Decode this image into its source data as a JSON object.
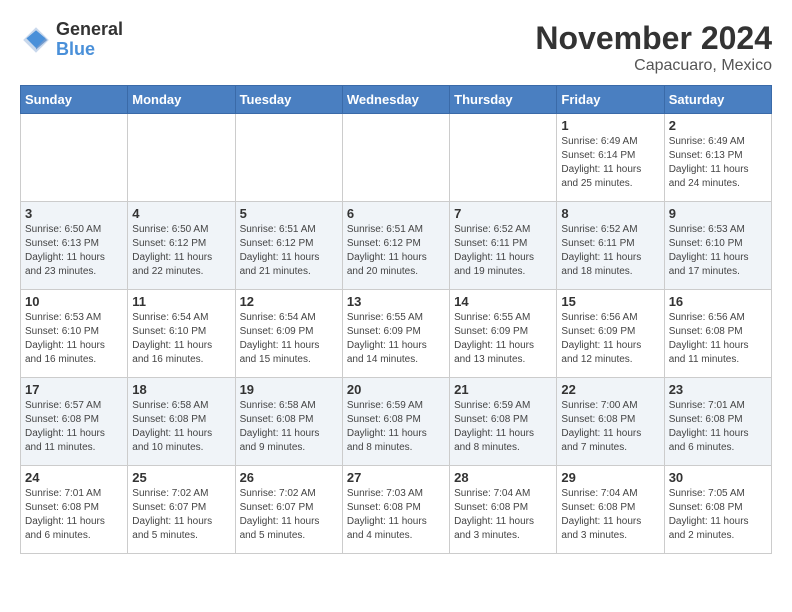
{
  "header": {
    "logo_line1": "General",
    "logo_line2": "Blue",
    "month": "November 2024",
    "location": "Capacuaro, Mexico"
  },
  "days_of_week": [
    "Sunday",
    "Monday",
    "Tuesday",
    "Wednesday",
    "Thursday",
    "Friday",
    "Saturday"
  ],
  "weeks": [
    [
      {
        "day": "",
        "info": ""
      },
      {
        "day": "",
        "info": ""
      },
      {
        "day": "",
        "info": ""
      },
      {
        "day": "",
        "info": ""
      },
      {
        "day": "",
        "info": ""
      },
      {
        "day": "1",
        "info": "Sunrise: 6:49 AM\nSunset: 6:14 PM\nDaylight: 11 hours and 25 minutes."
      },
      {
        "day": "2",
        "info": "Sunrise: 6:49 AM\nSunset: 6:13 PM\nDaylight: 11 hours and 24 minutes."
      }
    ],
    [
      {
        "day": "3",
        "info": "Sunrise: 6:50 AM\nSunset: 6:13 PM\nDaylight: 11 hours and 23 minutes."
      },
      {
        "day": "4",
        "info": "Sunrise: 6:50 AM\nSunset: 6:12 PM\nDaylight: 11 hours and 22 minutes."
      },
      {
        "day": "5",
        "info": "Sunrise: 6:51 AM\nSunset: 6:12 PM\nDaylight: 11 hours and 21 minutes."
      },
      {
        "day": "6",
        "info": "Sunrise: 6:51 AM\nSunset: 6:12 PM\nDaylight: 11 hours and 20 minutes."
      },
      {
        "day": "7",
        "info": "Sunrise: 6:52 AM\nSunset: 6:11 PM\nDaylight: 11 hours and 19 minutes."
      },
      {
        "day": "8",
        "info": "Sunrise: 6:52 AM\nSunset: 6:11 PM\nDaylight: 11 hours and 18 minutes."
      },
      {
        "day": "9",
        "info": "Sunrise: 6:53 AM\nSunset: 6:10 PM\nDaylight: 11 hours and 17 minutes."
      }
    ],
    [
      {
        "day": "10",
        "info": "Sunrise: 6:53 AM\nSunset: 6:10 PM\nDaylight: 11 hours and 16 minutes."
      },
      {
        "day": "11",
        "info": "Sunrise: 6:54 AM\nSunset: 6:10 PM\nDaylight: 11 hours and 16 minutes."
      },
      {
        "day": "12",
        "info": "Sunrise: 6:54 AM\nSunset: 6:09 PM\nDaylight: 11 hours and 15 minutes."
      },
      {
        "day": "13",
        "info": "Sunrise: 6:55 AM\nSunset: 6:09 PM\nDaylight: 11 hours and 14 minutes."
      },
      {
        "day": "14",
        "info": "Sunrise: 6:55 AM\nSunset: 6:09 PM\nDaylight: 11 hours and 13 minutes."
      },
      {
        "day": "15",
        "info": "Sunrise: 6:56 AM\nSunset: 6:09 PM\nDaylight: 11 hours and 12 minutes."
      },
      {
        "day": "16",
        "info": "Sunrise: 6:56 AM\nSunset: 6:08 PM\nDaylight: 11 hours and 11 minutes."
      }
    ],
    [
      {
        "day": "17",
        "info": "Sunrise: 6:57 AM\nSunset: 6:08 PM\nDaylight: 11 hours and 11 minutes."
      },
      {
        "day": "18",
        "info": "Sunrise: 6:58 AM\nSunset: 6:08 PM\nDaylight: 11 hours and 10 minutes."
      },
      {
        "day": "19",
        "info": "Sunrise: 6:58 AM\nSunset: 6:08 PM\nDaylight: 11 hours and 9 minutes."
      },
      {
        "day": "20",
        "info": "Sunrise: 6:59 AM\nSunset: 6:08 PM\nDaylight: 11 hours and 8 minutes."
      },
      {
        "day": "21",
        "info": "Sunrise: 6:59 AM\nSunset: 6:08 PM\nDaylight: 11 hours and 8 minutes."
      },
      {
        "day": "22",
        "info": "Sunrise: 7:00 AM\nSunset: 6:08 PM\nDaylight: 11 hours and 7 minutes."
      },
      {
        "day": "23",
        "info": "Sunrise: 7:01 AM\nSunset: 6:08 PM\nDaylight: 11 hours and 6 minutes."
      }
    ],
    [
      {
        "day": "24",
        "info": "Sunrise: 7:01 AM\nSunset: 6:08 PM\nDaylight: 11 hours and 6 minutes."
      },
      {
        "day": "25",
        "info": "Sunrise: 7:02 AM\nSunset: 6:07 PM\nDaylight: 11 hours and 5 minutes."
      },
      {
        "day": "26",
        "info": "Sunrise: 7:02 AM\nSunset: 6:07 PM\nDaylight: 11 hours and 5 minutes."
      },
      {
        "day": "27",
        "info": "Sunrise: 7:03 AM\nSunset: 6:08 PM\nDaylight: 11 hours and 4 minutes."
      },
      {
        "day": "28",
        "info": "Sunrise: 7:04 AM\nSunset: 6:08 PM\nDaylight: 11 hours and 3 minutes."
      },
      {
        "day": "29",
        "info": "Sunrise: 7:04 AM\nSunset: 6:08 PM\nDaylight: 11 hours and 3 minutes."
      },
      {
        "day": "30",
        "info": "Sunrise: 7:05 AM\nSunset: 6:08 PM\nDaylight: 11 hours and 2 minutes."
      }
    ]
  ]
}
